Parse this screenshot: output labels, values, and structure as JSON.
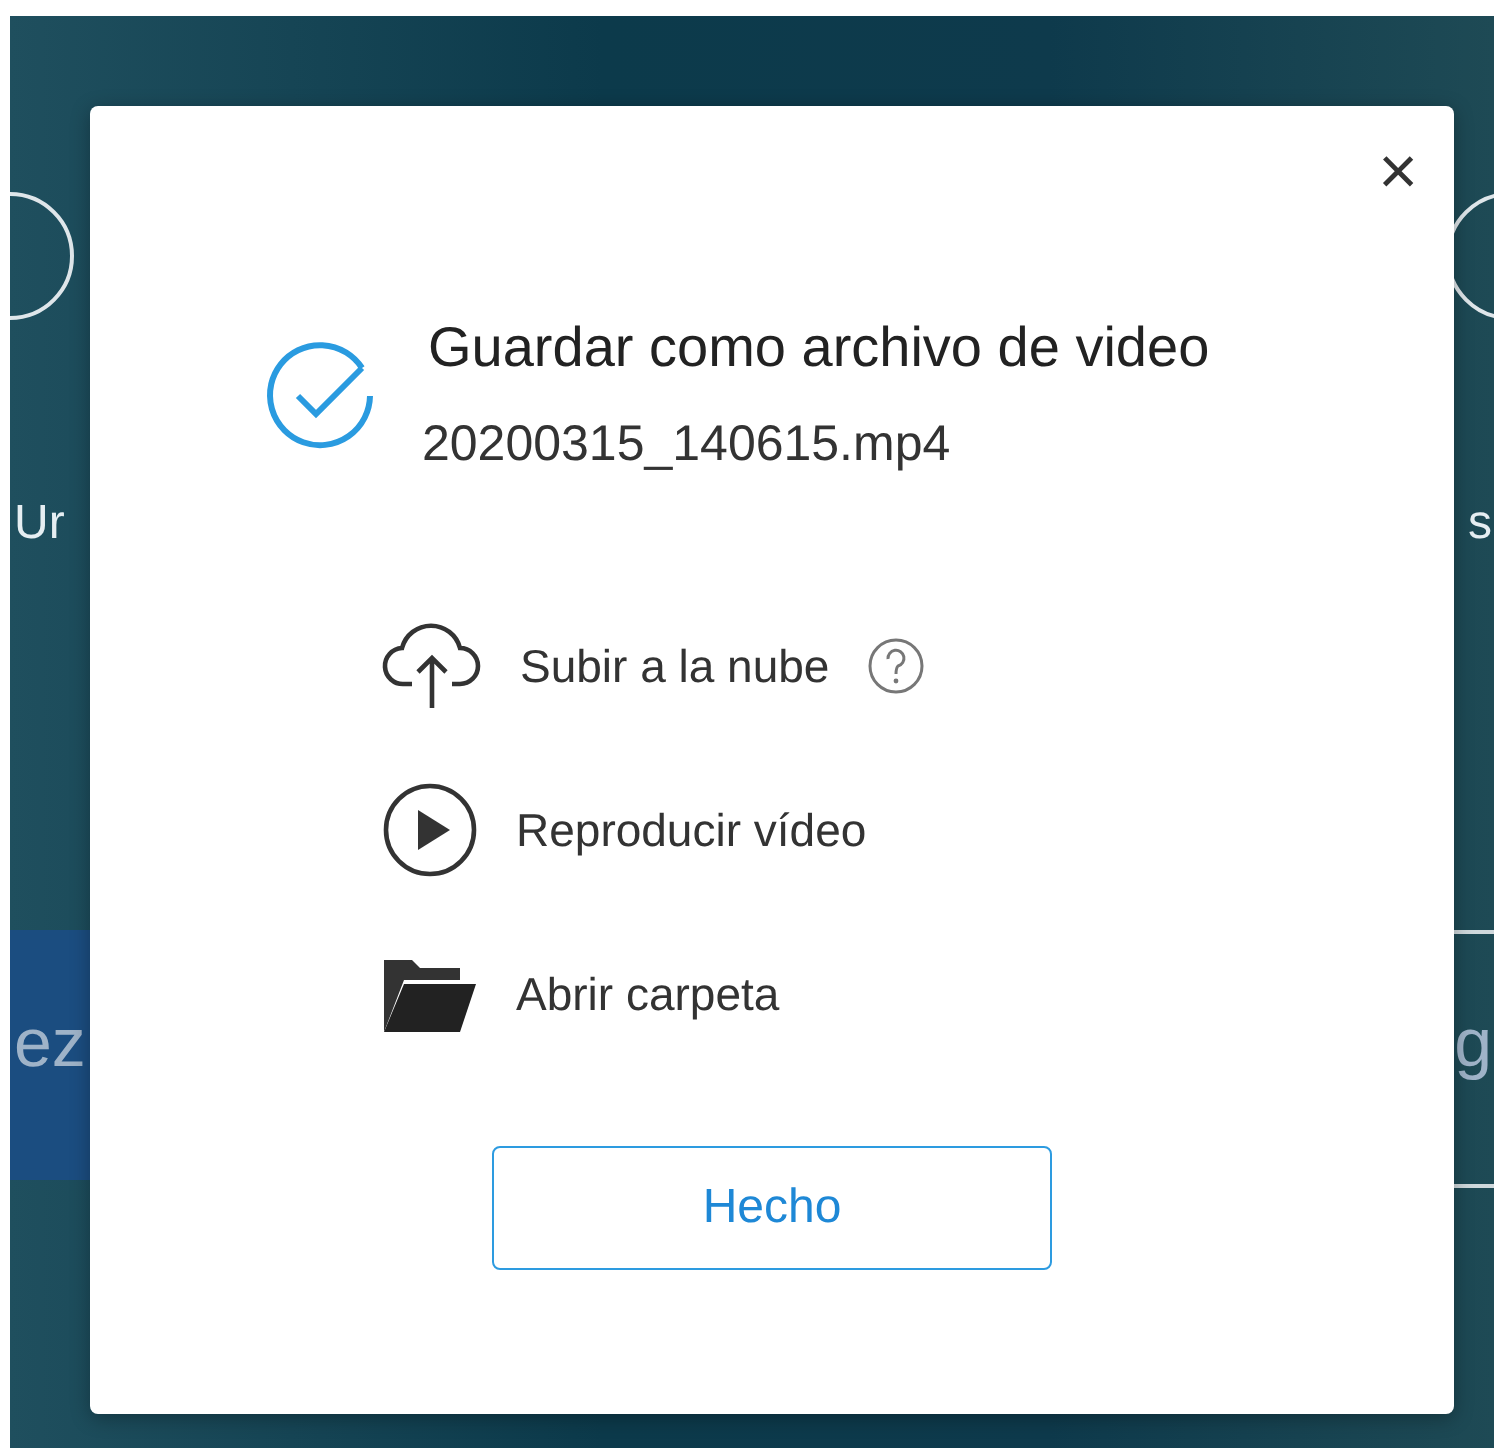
{
  "background": {
    "left_texts": [
      "Ur",
      "ez"
    ],
    "right_texts": [
      "s",
      "g"
    ]
  },
  "dialog": {
    "close": "×",
    "title": "Guardar como archivo de video",
    "filename": "20200315_140615.mp4",
    "actions": [
      {
        "kind": "upload",
        "label": "Subir a la nube",
        "help": true
      },
      {
        "kind": "play",
        "label": "Reproducir vídeo",
        "help": false
      },
      {
        "kind": "folder",
        "label": "Abrir carpeta",
        "help": false
      }
    ],
    "button": "Hecho"
  }
}
